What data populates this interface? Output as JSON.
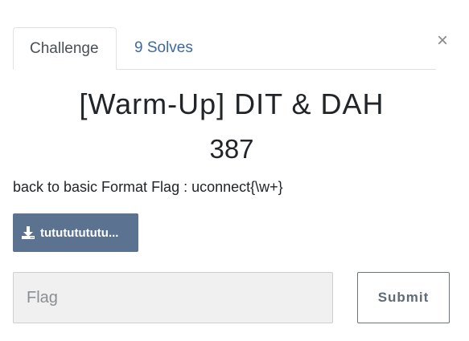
{
  "modal": {
    "close_label": "×"
  },
  "tabs": [
    {
      "label": "Challenge",
      "active": true
    },
    {
      "label": "9 Solves",
      "active": false
    }
  ],
  "challenge": {
    "title": "[Warm-Up] DIT & DAH",
    "points": "387",
    "description": "back to basic Format Flag : uconnect{\\w+}"
  },
  "file": {
    "label": "tutututututu...",
    "icon": "download-icon"
  },
  "form": {
    "flag_placeholder": "Flag",
    "flag_value": "",
    "submit_label": "Submit"
  },
  "colors": {
    "file_button_bg": "#5b7290",
    "tab_link": "#3c6aa0",
    "input_bg": "#f0f0f0"
  }
}
